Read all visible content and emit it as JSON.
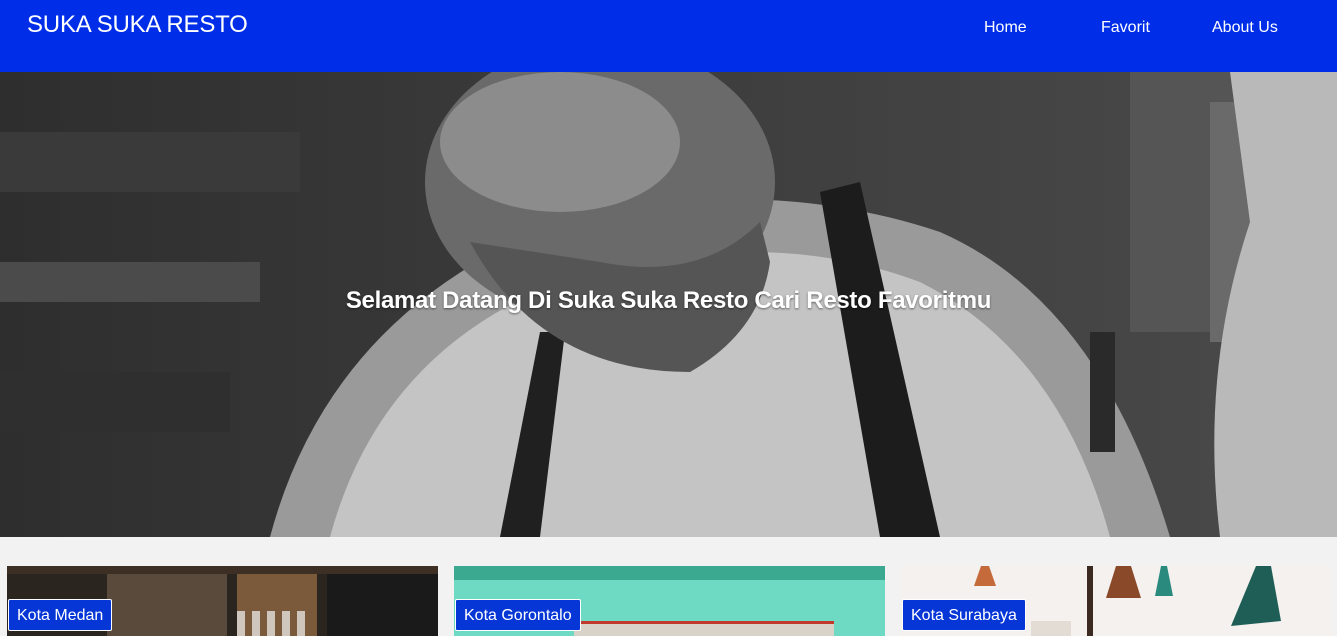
{
  "header": {
    "brand": "SUKA SUKA RESTO",
    "nav": {
      "home": "Home",
      "favorite": "Favorit",
      "about": "About Us"
    },
    "background_color": "#002ee8"
  },
  "hero": {
    "title": "Selamat Datang Di Suka Suka Resto Cari Resto Favoritmu"
  },
  "restaurants": [
    {
      "city": "Kota Medan"
    },
    {
      "city": "Kota Gorontalo"
    },
    {
      "city": "Kota Surabaya"
    }
  ],
  "colors": {
    "accent": "#002ee8",
    "badge": "#0736d6",
    "page_background": "#f2f2f2"
  }
}
